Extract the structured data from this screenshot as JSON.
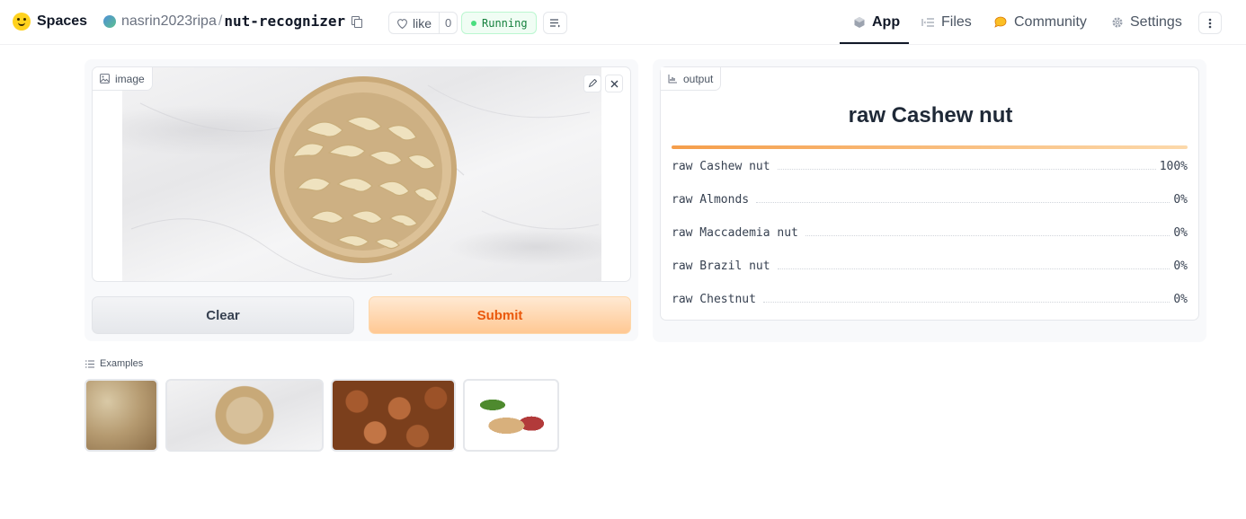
{
  "header": {
    "brand": "Spaces",
    "owner": "nasrin2023ripa",
    "separator": "/",
    "repo": "nut-recognizer",
    "like_label": "like",
    "like_count": "0",
    "status": "Running",
    "nav": {
      "app": "App",
      "files": "Files",
      "community": "Community",
      "settings": "Settings"
    }
  },
  "input_panel": {
    "image_label": "image",
    "clear_label": "Clear",
    "submit_label": "Submit"
  },
  "output_panel": {
    "label": "output",
    "prediction": "raw Cashew nut",
    "confidences": [
      {
        "label": "raw Cashew nut",
        "value": "100%",
        "fraction": 1.0
      },
      {
        "label": "raw Almonds",
        "value": "0%",
        "fraction": 0
      },
      {
        "label": "raw Maccademia nut",
        "value": "0%",
        "fraction": 0
      },
      {
        "label": "raw Brazil nut",
        "value": "0%",
        "fraction": 0
      },
      {
        "label": "raw Chestnut",
        "value": "0%",
        "fraction": 0
      }
    ]
  },
  "examples": {
    "label": "Examples"
  },
  "colors": {
    "accent": "#ea580c",
    "running_green": "#15803d"
  }
}
